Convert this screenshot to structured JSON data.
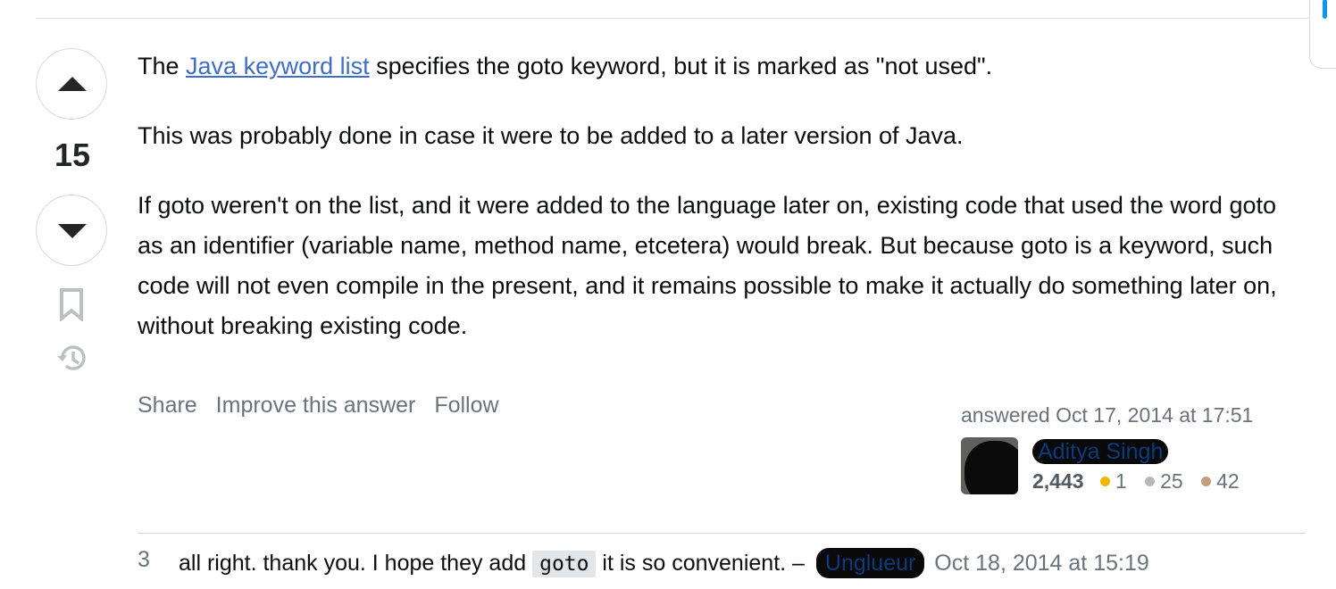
{
  "post": {
    "score": "15",
    "p1": {
      "before": "The ",
      "link": "Java keyword list",
      "after": " specifies the goto keyword, but it is marked as \"not used\"."
    },
    "p2": "This was probably done in case it were to be added to a later version of Java.",
    "p3": "If goto weren't on the list, and it were added to the language later on, existing code that used the word goto as an identifier (variable name, method name, etcetera) would break. But because goto is a keyword, such code will not even compile in the present, and it remains possible to make it actually do something later on, without breaking existing code."
  },
  "actions": {
    "share": "Share",
    "improve": "Improve this answer",
    "follow": "Follow"
  },
  "user": {
    "answered": "answered Oct 17, 2014 at 17:51",
    "name": "Aditya Singh",
    "reputation": "2,443",
    "gold": "1",
    "silver": "25",
    "bronze": "42"
  },
  "comment": {
    "score": "3",
    "text_before": "all right. thank you. I hope they add ",
    "code": "goto",
    "text_after": " it is so convenient. – ",
    "user": "Unglueur",
    "date": "Oct 18, 2014 at 15:19"
  },
  "colors": {
    "link": "#3f6dca",
    "gold": "#f1b600",
    "silver": "#b8b8b8",
    "bronze": "#c59d7d"
  },
  "icons": [
    "vote-up-icon",
    "vote-down-icon",
    "bookmark-icon",
    "history-icon"
  ]
}
